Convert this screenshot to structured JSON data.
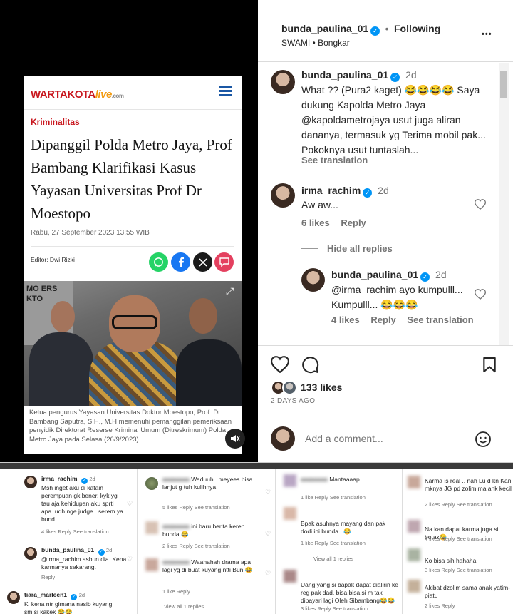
{
  "article": {
    "logo_main": "WARTAKOTA",
    "logo_live": "live",
    "logo_com": ".com",
    "category": "Kriminalitas",
    "headline": "Dipanggil Polda Metro Jaya, Prof Bambang Klarifikasi Kasus Yayasan Universitas Prof Dr Moestopo",
    "date": "Rabu, 27 September 2023 13:55 WIB",
    "editor": "Editor: Dwi Rizki",
    "photo_sign_text": "MO ERS KTO",
    "caption": "Ketua pengurus Yayasan Universitas Doktor Moestopo, Prof. Dr. Bambang Saputra, S.H., M.H memenuhi pemanggilan pemeriksaan penyidik Direktorat Reserse Kriminal Umum (Ditreskrimum) Polda Metro Jaya pada Selasa (26/9/2023)."
  },
  "post": {
    "username": "bunda_paulina_01",
    "follow_label": "Following",
    "separator": "•",
    "audio": "SWAMI • Bongkar",
    "more": "•••",
    "likes": "133 likes",
    "date": "2 DAYS AGO",
    "comment_placeholder": "Add a comment...",
    "comments": [
      {
        "user": "bunda_paulina_01",
        "time": "2d",
        "text": "What ?? (Pura2 kaget) 😂😂😂😂 Saya dukung Kapolda Metro Jaya @kapoldametrojaya usut juga aliran dananya, termasuk yg Terima mobil pak... Pokoknya usut tuntaslah...",
        "translate": "See translation"
      },
      {
        "user": "irma_rachim",
        "time": "2d",
        "text": "Aw aw...",
        "likes": "6 likes",
        "reply": "Reply",
        "hide_replies": "Hide all replies"
      },
      {
        "user": "bunda_paulina_01",
        "time": "2d",
        "text": "@irma_rachim ayo kumpulll... Kumpulll... 😂😂😂",
        "likes": "4 likes",
        "reply": "Reply",
        "translate": "See translation"
      }
    ]
  },
  "lower": {
    "col1": [
      {
        "user": "irma_rachim",
        "time": "2d",
        "text": "Msh inget aku di katain perempuan gk bener, kyk yg tau aja kehidupan aku sprti apa..udh nge judge . serem ya bund",
        "meta": "4 likes   Reply   See translation"
      },
      {
        "user": "bunda_paulina_01",
        "time": "2d",
        "text": "@irma_rachim asbun dia. Kena karmanya sekarang.",
        "meta": "Reply"
      },
      {
        "user": "tiara_marleen1",
        "time": "2d",
        "text": "Kl kena ntr gimana nasib kuyang sm si kakek 😂😂",
        "meta": ""
      }
    ],
    "col2": [
      {
        "user": "",
        "text": "Waduuh...meyees bisa lanjut g tuh kulihnya",
        "meta": "5 likes   Reply   See translation"
      },
      {
        "user": "",
        "text": "ini baru berita keren bunda 😂",
        "meta": "2 likes   Reply   See translation"
      },
      {
        "user": "",
        "text": "Waahahah drama apa lagi yg di buat kuyang ntti Bun 😂",
        "meta": "1 like   Reply"
      },
      {
        "user": "",
        "text": "View all 1 replies",
        "meta": ""
      }
    ],
    "col3": [
      {
        "user": "",
        "text": "Mantaaaap",
        "meta": "1 like   Reply   See translation"
      },
      {
        "user": "",
        "text": "Bpak asuhnya mayang dan pak dodi ini bunda.. 😂",
        "meta": "1 like   Reply   See translation"
      },
      {
        "user": "",
        "text": "View all 1 replies",
        "meta": ""
      },
      {
        "user": "",
        "text": "Uang yang si bapak dapat dialirin ke reg pak dad. bisa bisa si m tak dibayari lagi Oleh Sibambang😂😂",
        "meta": "3 likes   Reply   See translation"
      }
    ],
    "col4": [
      {
        "user": "",
        "text": "Karma is real .. nah Lu d kn Kan mknya JG pd zolim ma ank kecil",
        "meta": "2 likes   Reply   See translation"
      },
      {
        "user": "",
        "text": "Na kan dapat karma juga si botak😂",
        "meta": "4 likes   Reply   See translation"
      },
      {
        "user": "",
        "text": "Ko bisa sih hahaha",
        "meta": "3 likes   Reply   See translation"
      },
      {
        "user": "",
        "text": "Akibat dzolim sama anak yatim-piatu",
        "meta": "2 likes   Reply"
      }
    ]
  },
  "colors": {
    "verified": "#0095f6",
    "brand_red": "#c8161d",
    "whatsapp": "#25d366",
    "facebook": "#1877f2",
    "x": "#000000",
    "comment_icon": "#e4405f"
  }
}
